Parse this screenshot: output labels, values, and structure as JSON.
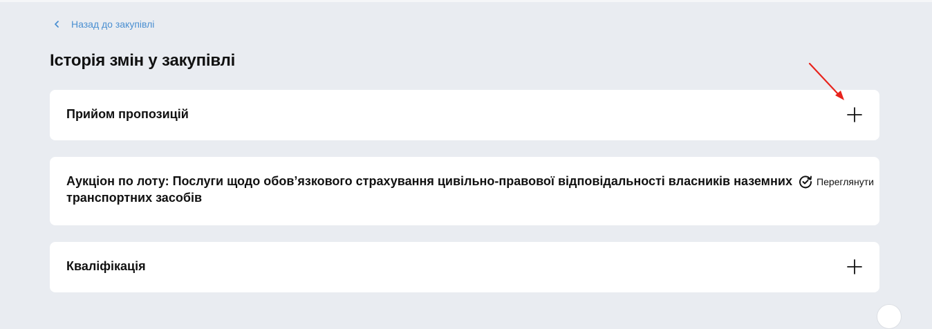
{
  "back_link": {
    "label": "Назад до закупівлі",
    "icon": "chevron-left-icon"
  },
  "page_title": "Історія змін у закупівлі",
  "sections": [
    {
      "title": "Прийом пропозицій",
      "action_icon": "plus-icon"
    },
    {
      "title": "Аукціон по лоту: Послуги щодо обов’язкового страхування цивільно-правової відповідальності власників наземних транспортних засобів",
      "action_label": "Переглянути",
      "action_icon": "refresh-check-icon"
    },
    {
      "title": "Кваліфікація",
      "action_icon": "plus-icon"
    }
  ],
  "colors": {
    "background": "#e9ecf1",
    "card": "#ffffff",
    "link": "#4a8fd1",
    "annotation_arrow": "#e8231c"
  }
}
